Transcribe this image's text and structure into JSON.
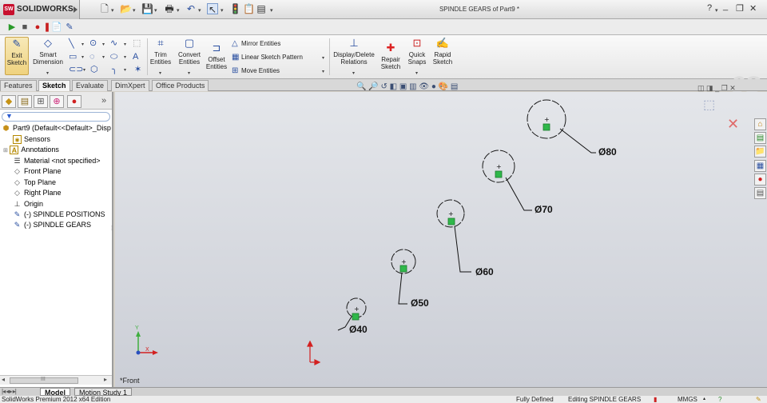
{
  "app": {
    "logo_badge": "SW",
    "name": "SOLIDWORKS",
    "document_title": "SPINDLE GEARS  of Part9 *"
  },
  "titlebar": {
    "icons": [
      "new-doc-icon",
      "open-icon",
      "save-icon",
      "print-icon",
      "undo-icon",
      "select-icon",
      "rebuild-icon",
      "file-properties-icon",
      "options-icon"
    ],
    "help": "?",
    "window_controls": [
      "_",
      "❐",
      "✕"
    ]
  },
  "quickrow": {
    "icons": [
      "play-icon",
      "stop-icon",
      "record-icon",
      "macro-icon",
      "edit-macro-icon"
    ]
  },
  "ribbon": {
    "exit_sketch": [
      "Exit",
      "Sketch"
    ],
    "smart_dimension": [
      "Smart",
      "Dimension"
    ],
    "trim_entities": [
      "Trim",
      "Entities"
    ],
    "convert_entities": [
      "Convert",
      "Entities"
    ],
    "offset_entities": [
      "Offset",
      "Entities"
    ],
    "mirror_entities": "Mirror Entities",
    "linear_sketch_pattern": "Linear Sketch Pattern",
    "move_entities": "Move Entities",
    "display_delete_relations": [
      "Display/Delete",
      "Relations"
    ],
    "repair_sketch": [
      "Repair",
      "Sketch"
    ],
    "quick_snaps": [
      "Quick",
      "Snaps"
    ],
    "rapid_sketch": [
      "Rapid",
      "Sketch"
    ]
  },
  "command_tabs": [
    "Features",
    "Sketch",
    "Evaluate",
    "DimXpert",
    "Office Products"
  ],
  "active_command_tab": "Sketch",
  "feature_tree": {
    "filter_symbol": "▼",
    "collapse_arrows": "»",
    "items": [
      {
        "label": "Part9  (Default<<Default>_Disp",
        "icon": "part-icon"
      },
      {
        "label": "Sensors",
        "icon": "sensors-icon"
      },
      {
        "label": "Annotations",
        "icon": "annotations-icon"
      },
      {
        "label": "Material <not specified>",
        "icon": "material-icon"
      },
      {
        "label": "Front Plane",
        "icon": "plane-icon"
      },
      {
        "label": "Top Plane",
        "icon": "plane-icon"
      },
      {
        "label": "Right Plane",
        "icon": "plane-icon"
      },
      {
        "label": "Origin",
        "icon": "origin-icon"
      },
      {
        "label": "(-) SPINDLE POSITIONS",
        "icon": "sketch-icon"
      },
      {
        "label": "(-) SPINDLE GEARS",
        "icon": "sketch-icon"
      }
    ],
    "scroll_glyph": "III"
  },
  "canvas": {
    "view_name": "*Front",
    "dimensions": [
      "Ø40",
      "Ø50",
      "Ø60",
      "Ø70",
      "Ø80"
    ],
    "triad_labels": {
      "y": "Y",
      "x": "X"
    }
  },
  "bottom_tabs": [
    "Model",
    "Motion Study 1"
  ],
  "active_bottom_tab": "Model",
  "status_bar": {
    "edition": "SolidWorks Premium 2012 x64 Edition",
    "definition_state": "Fully Defined",
    "editing": "Editing SPINDLE GEARS",
    "units": "MMGS"
  }
}
